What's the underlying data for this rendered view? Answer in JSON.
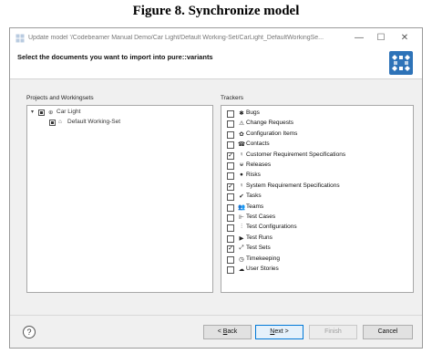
{
  "figure_caption": "Figure 8. Synchronize model",
  "window": {
    "title": "Update model '/Codebeamer Manual Demo/Car Light/Default Working-Set/CarLight_DefaultWorkingSe...",
    "minimize_glyph": "—",
    "maximize_glyph": "☐",
    "close_glyph": "✕"
  },
  "header": {
    "instruction": "Select the documents you want to import into pure::variants"
  },
  "projects": {
    "label": "Projects and Workingsets",
    "tree": [
      {
        "label": "Car Light",
        "expanded": true,
        "state": "partial",
        "icon": "project-icon"
      },
      {
        "label": "Default Working-Set",
        "state": "partial",
        "icon": "working-set-icon"
      }
    ]
  },
  "trackers": {
    "label": "Trackers",
    "items": [
      {
        "label": "Bugs",
        "checked": false,
        "icon": "bug-icon",
        "glyph": "✱"
      },
      {
        "label": "Change Requests",
        "checked": false,
        "icon": "warning-icon",
        "glyph": "⚠"
      },
      {
        "label": "Configuration Items",
        "checked": false,
        "icon": "gear-icon",
        "glyph": "✿"
      },
      {
        "label": "Contacts",
        "checked": false,
        "icon": "phone-icon",
        "glyph": "☎"
      },
      {
        "label": "Customer Requirement Specifications",
        "checked": true,
        "icon": "bulb-icon",
        "glyph": "♀"
      },
      {
        "label": "Releases",
        "checked": false,
        "icon": "release-icon",
        "glyph": "ᵾ"
      },
      {
        "label": "Risks",
        "checked": false,
        "icon": "bomb-icon",
        "glyph": "●"
      },
      {
        "label": "System Requirement Specifications",
        "checked": true,
        "icon": "bulb-icon",
        "glyph": "♀"
      },
      {
        "label": "Tasks",
        "checked": false,
        "icon": "check-icon",
        "glyph": "✔"
      },
      {
        "label": "Teams",
        "checked": false,
        "icon": "team-icon",
        "glyph": "👥"
      },
      {
        "label": "Test Cases",
        "checked": false,
        "icon": "test-case-icon",
        "glyph": "⊩"
      },
      {
        "label": "Test Configurations",
        "checked": false,
        "icon": "test-config-icon",
        "glyph": "⫶"
      },
      {
        "label": "Test Runs",
        "checked": false,
        "icon": "play-icon",
        "glyph": "▶"
      },
      {
        "label": "Test Sets",
        "checked": true,
        "icon": "test-set-icon",
        "glyph": "⤢"
      },
      {
        "label": "Timekeeping",
        "checked": false,
        "icon": "clock-icon",
        "glyph": "◷"
      },
      {
        "label": "User Stories",
        "checked": false,
        "icon": "cloud-icon",
        "glyph": "☁"
      }
    ]
  },
  "footer": {
    "help_glyph": "?",
    "back_mnemonic": "B",
    "back_label": "ack",
    "back_prefix": "< ",
    "next_mnemonic": "N",
    "next_label": "ext >",
    "finish_label": "Finish",
    "cancel_label": "Cancel"
  },
  "colors": {
    "accent": "#0078d7",
    "logo": "#2e73b8"
  }
}
